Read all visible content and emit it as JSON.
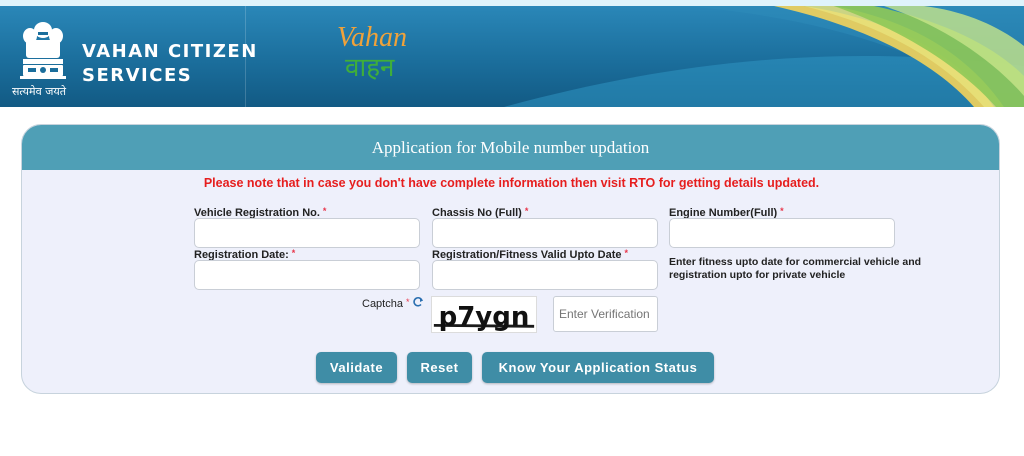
{
  "header": {
    "brand_line1": "VAHAN CITIZEN",
    "brand_line2": "SERVICES",
    "emblem_motto": "सत्यमेव जयते",
    "logo_en": "Vahan",
    "logo_hi": "वाहन"
  },
  "form": {
    "title": "Application for Mobile number updation",
    "notice": "Please note that in case you don't have complete information then visit RTO for getting details updated.",
    "required_mark": "*",
    "fields": {
      "vehicle_reg_label": "Vehicle Registration No.",
      "chassis_label": "Chassis No (Full)",
      "engine_label": "Engine Number(Full)",
      "reg_date_label": "Registration Date:",
      "fitness_label": "Registration/Fitness Valid Upto Date",
      "vehicle_reg_value": "",
      "chassis_value": "",
      "engine_value": "",
      "reg_date_value": "",
      "fitness_value": ""
    },
    "hint": "Enter fitness upto date for commercial vehicle and registration upto for private vehicle",
    "captcha": {
      "label": "Captcha",
      "image_text": "p7ygn",
      "input_placeholder": "Enter Verification Code"
    },
    "buttons": {
      "validate": "Validate",
      "reset": "Reset",
      "status": "Know Your Application Status"
    }
  },
  "colors": {
    "header_blue": "#1b6e9c",
    "card_header": "#4f9fb6",
    "card_bg": "#eef0fb",
    "notice_red": "#e61e1e",
    "button": "#3f8da6"
  }
}
